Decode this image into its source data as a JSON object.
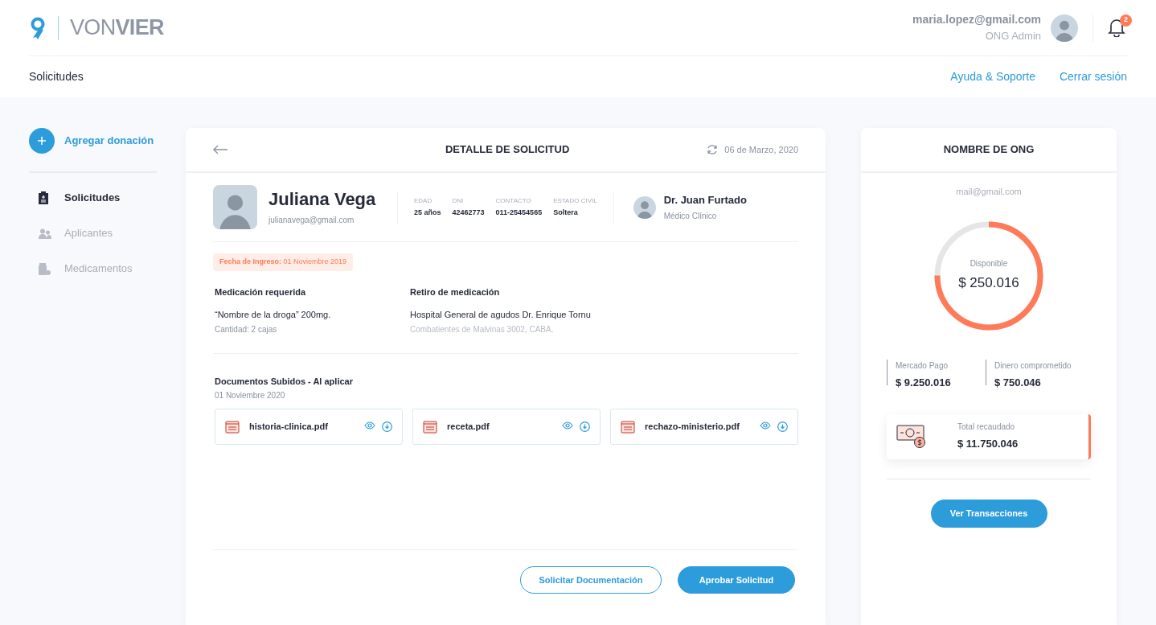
{
  "header": {
    "logo_light": "VON",
    "logo_bold": "VIER",
    "user_email": "maria.lopez@gmail.com",
    "user_role": "ONG Admin",
    "notifications": "2"
  },
  "subheader": {
    "title": "Solicitudes",
    "links": [
      "Ayuda & Soporte",
      "Cerrar sesión"
    ]
  },
  "sidebar": {
    "add_button": "Agregar donación",
    "items": [
      {
        "label": "Solicitudes",
        "kind": "clipboard",
        "selected": true
      },
      {
        "label": "Aplicantes",
        "kind": "people",
        "selected": false
      },
      {
        "label": "Medicamentos",
        "kind": "medicine",
        "selected": false
      }
    ]
  },
  "detail": {
    "title": "DETALLE DE SOLICITUD",
    "date": "06 de Marzo, 2020",
    "applicant": {
      "name": "Juliana Vega",
      "email": "julianavega@gmail.com"
    },
    "facts": [
      {
        "label": "EDAD",
        "value": "25 años"
      },
      {
        "label": "DNI",
        "value": "42462773"
      },
      {
        "label": "CONTACTO",
        "value": "011-25454565"
      },
      {
        "label": "ESTADO CIVIL",
        "value": "Soltera"
      }
    ],
    "doctor": {
      "name": "Dr. Juan Furtado",
      "role": "Médico Clínico"
    },
    "admission": "**Fecha de Ingreso:** 01 Noviembre 2019",
    "medication": {
      "heading": "Medicación requerida",
      "name": "“Nombre de la droga” 200mg.",
      "quantity": "Cantidad: 2 cajas"
    },
    "pickup": {
      "heading": "Retiro de medicación",
      "place": "Hospital General de agudos Dr. Enrique Tornu",
      "address": "Combatientes de Malvinas 3002, CABA."
    },
    "documents": {
      "heading": "Documentos Subidos - Al aplicar",
      "date": "01 Noviembre 2020",
      "files": [
        "historia-clinica.pdf",
        "receta.pdf",
        "rechazo-ministerio.pdf"
      ]
    },
    "actions": [
      {
        "label": "Solicitar Documentación",
        "kind": "outline"
      },
      {
        "label": "Aprobar Solicitud",
        "kind": "primary"
      }
    ]
  },
  "org": {
    "title": "NOMBRE DE ONG",
    "email": "mail@gmail.com",
    "donut": {
      "label": "Disponible",
      "amount": "$ 250.016",
      "level": 0.75
    },
    "stats": [
      {
        "label": "Mercado Pago",
        "value": "$ 9.250.016"
      },
      {
        "label": "Dinero comprometido",
        "value": "$ 750.046"
      }
    ],
    "total": {
      "label": "Total recaudado",
      "value": "$ 11.750.046"
    },
    "button": "Ver Transacciones"
  }
}
